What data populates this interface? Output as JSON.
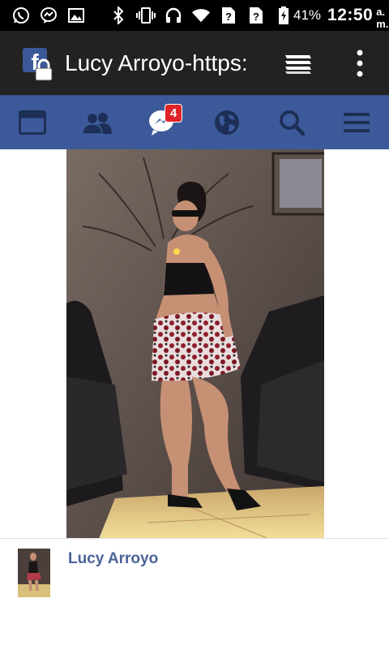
{
  "status_bar": {
    "battery_percent": "41%",
    "time": "12:50",
    "ampm": "a. m.",
    "icons": [
      "whatsapp-icon",
      "messenger-icon",
      "gallery-icon",
      "bluetooth-icon",
      "vibrate-icon",
      "headset-icon",
      "wifi-icon",
      "no-sim-icon",
      "no-sim-icon",
      "battery-charging-icon"
    ]
  },
  "app_bar": {
    "title": "Lucy Arroyo-https:",
    "icons": [
      "facebook-lite-locked-icon",
      "tabs-icon",
      "overflow-menu-icon"
    ]
  },
  "fb_nav": {
    "items": [
      "news-feed-icon",
      "friends-icon",
      "messenger-icon",
      "globe-icon",
      "search-icon",
      "menu-icon"
    ],
    "messages_badge": "4",
    "background_color": "#3c5a99"
  },
  "post": {
    "author": "Lucy Arroyo",
    "author_color": "#4b6399"
  }
}
